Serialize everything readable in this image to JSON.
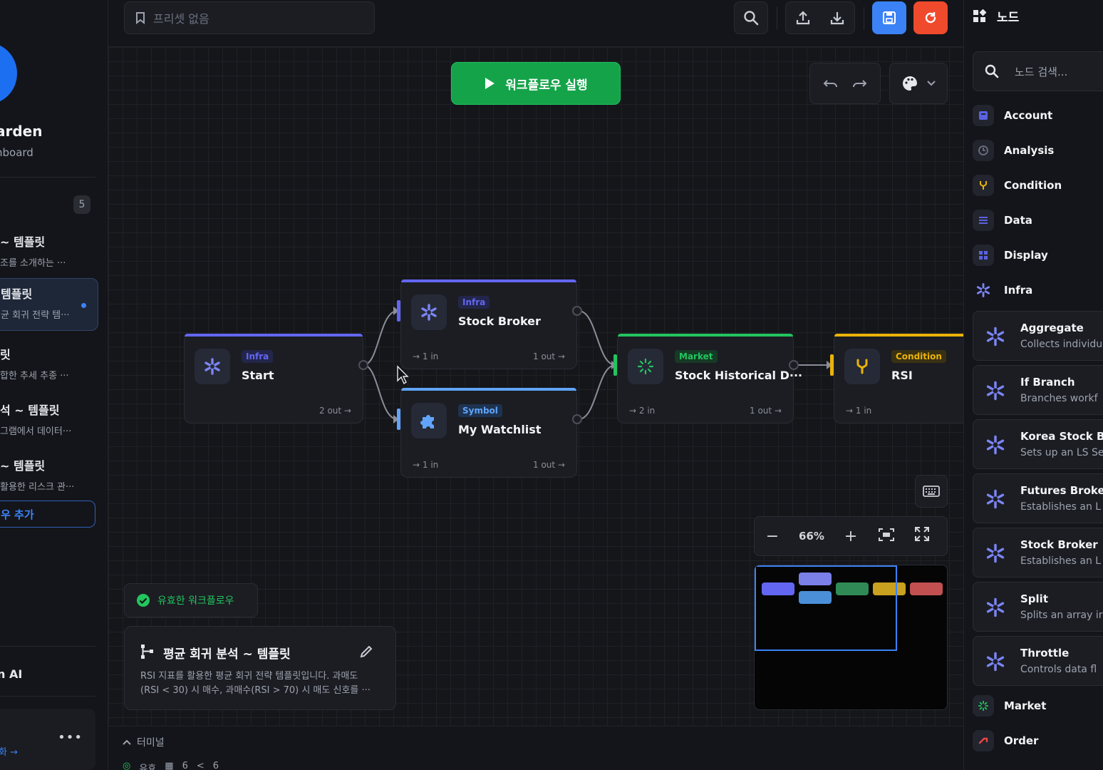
{
  "sidebar": {
    "workspace_title": "arden",
    "workspace_sub": "hboard",
    "count": "5",
    "workflows": [
      {
        "title": "~ 템플릿",
        "desc": "조를 소개하는 ···",
        "active": false
      },
      {
        "title": "템플릿",
        "desc": "균 회귀 전략 템···",
        "active": true
      },
      {
        "title": "릿",
        "desc": "합한 추세 추종 ···",
        "active": false
      },
      {
        "title": "석 ~ 템플릿",
        "desc": "그램에서 데이터···",
        "active": false
      },
      {
        "title": "~ 템플릿",
        "desc": "활용한 리스크 관···",
        "active": false
      }
    ],
    "add_label": "우 추가",
    "ai_label": "n AI",
    "bottom_link": "화 →"
  },
  "topbar": {
    "preset_placeholder": "프리셋 없음"
  },
  "canvas": {
    "run_label": "워크플로우 실행",
    "valid_label": "유효한 워크플로우",
    "info_title": "평균 회귀 분석 ~ 템플릿",
    "info_desc_1": "RSI 지표를 활용한 평균 회귀 전략 템플릿입니다. 과매도",
    "info_desc_2": "(RSI < 30) 시 매수, 과매수(RSI > 70) 시 매도 신호를 ···",
    "zoom": "66%"
  },
  "nodes": {
    "start": {
      "category": "Infra",
      "name": "Start",
      "port_out": "2 out →"
    },
    "broker": {
      "category": "Infra",
      "name": "Stock Broker",
      "port_in": "→ 1 in",
      "port_out": "1 out →"
    },
    "watchlist": {
      "category": "Symbol",
      "name": "My Watchlist",
      "port_in": "→ 1 in",
      "port_out": "1 out →"
    },
    "historical": {
      "category": "Market",
      "name": "Stock Historical D···",
      "port_in": "→ 2 in",
      "port_out": "1 out →"
    },
    "rsi": {
      "category": "Condition",
      "name": "RSI",
      "port_in": "→ 1 in"
    }
  },
  "terminal": {
    "label": "터미널",
    "status": "유효",
    "nodes_count": "6",
    "edges_count": "6"
  },
  "panel": {
    "title": "노드",
    "search_placeholder": "노드 검색...",
    "categories": [
      "Account",
      "Analysis",
      "Condition",
      "Data",
      "Display",
      "Infra"
    ],
    "infra_nodes": [
      {
        "title": "Aggregate",
        "desc": "Collects individu"
      },
      {
        "title": "If Branch",
        "desc": "Branches workf"
      },
      {
        "title": "Korea Stock Bro",
        "desc": "Sets up an LS Se"
      },
      {
        "title": "Futures Broker",
        "desc": "Establishes an L"
      },
      {
        "title": "Stock Broker",
        "desc": "Establishes an L"
      },
      {
        "title": "Split",
        "desc": "Splits an array ir"
      },
      {
        "title": "Throttle",
        "desc": "Controls data fl"
      }
    ],
    "bottom_categories": [
      "Market",
      "Order"
    ]
  },
  "colors": {
    "infra": "#6366f1",
    "symbol": "#60a5fa",
    "market": "#22c55e",
    "condition": "#eab308",
    "run": "#15a34a",
    "save": "#3b82f6",
    "refresh": "#f04a2d"
  }
}
